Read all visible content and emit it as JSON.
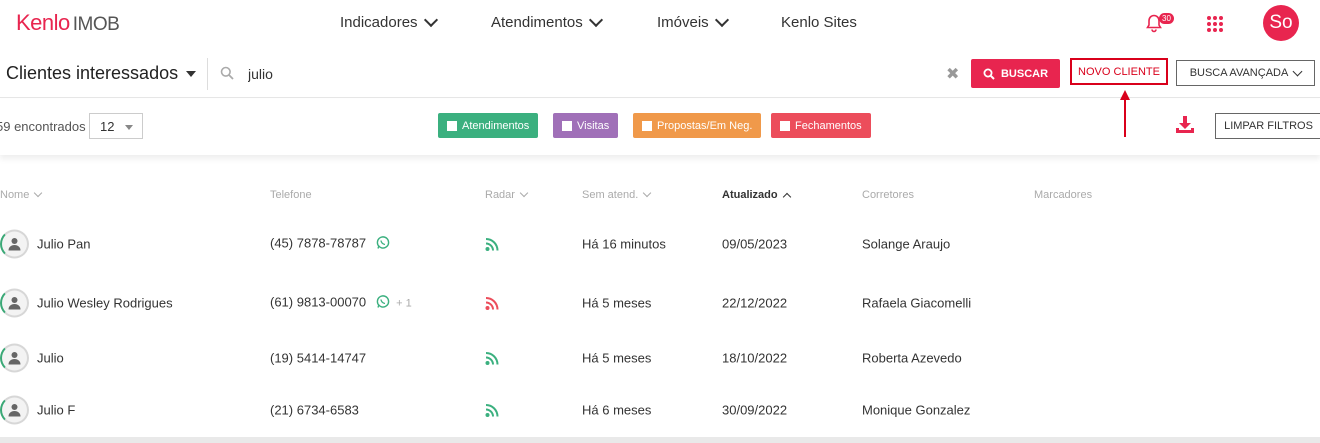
{
  "header": {
    "logo_brand": "Kenlo",
    "logo_product": "IMOB",
    "nav": [
      {
        "label": "Indicadores",
        "has_dropdown": true
      },
      {
        "label": "Atendimentos",
        "has_dropdown": true
      },
      {
        "label": "Imóveis",
        "has_dropdown": true
      },
      {
        "label": "Kenlo Sites",
        "has_dropdown": false
      }
    ],
    "notifications_count": "30",
    "avatar_initials": "So",
    "icons": [
      "bell-icon",
      "apps-grid-icon"
    ]
  },
  "search": {
    "list_selector": "Clientes interessados",
    "query": "julio",
    "search_button": "BUSCAR",
    "new_client_button": "NOVO CLIENTE",
    "advanced_search_button": "BUSCA AVANÇADA"
  },
  "filters": {
    "found_text": "59 encontrados",
    "per_page": "12",
    "chips": [
      {
        "label": "Atendimentos",
        "color": "#3bb07f"
      },
      {
        "label": "Visitas",
        "color": "#a070b8"
      },
      {
        "label": "Propostas/Em Neg.",
        "color": "#f0994a"
      },
      {
        "label": "Fechamentos",
        "color": "#ec4d5b"
      }
    ],
    "clear_button": "LIMPAR FILTROS"
  },
  "table": {
    "columns": [
      "Nome",
      "Telefone",
      "Radar",
      "Sem atend.",
      "Atualizado",
      "Corretores",
      "Marcadores"
    ],
    "sorted_column": "Atualizado",
    "rows": [
      {
        "name": "Julio Pan",
        "phone": "(45) 7878-78787",
        "whatsapp": true,
        "extra_phones": "",
        "radar_color": "#3bb07f",
        "no_contact": "Há 16 minutos",
        "updated": "09/05/2023",
        "broker": "Solange Araujo"
      },
      {
        "name": "Julio Wesley Rodrigues",
        "phone": "(61) 9813-00070",
        "whatsapp": true,
        "extra_phones": "+ 1",
        "radar_color": "#ec4d5b",
        "no_contact": "Há 5 meses",
        "updated": "22/12/2022",
        "broker": "Rafaela Giacomelli"
      },
      {
        "name": "Julio",
        "phone": "(19) 5414-14747",
        "whatsapp": false,
        "extra_phones": "",
        "radar_color": "#3bb07f",
        "no_contact": "Há 5 meses",
        "updated": "18/10/2022",
        "broker": "Roberta Azevedo"
      },
      {
        "name": "Julio F",
        "phone": "(21) 6734-6583",
        "whatsapp": false,
        "extra_phones": "",
        "radar_color": "#3bb07f",
        "no_contact": "Há 6 meses",
        "updated": "30/09/2022",
        "broker": "Monique Gonzalez"
      }
    ]
  },
  "colors": {
    "brand": "#e8254f",
    "highlight": "#d9001b"
  }
}
